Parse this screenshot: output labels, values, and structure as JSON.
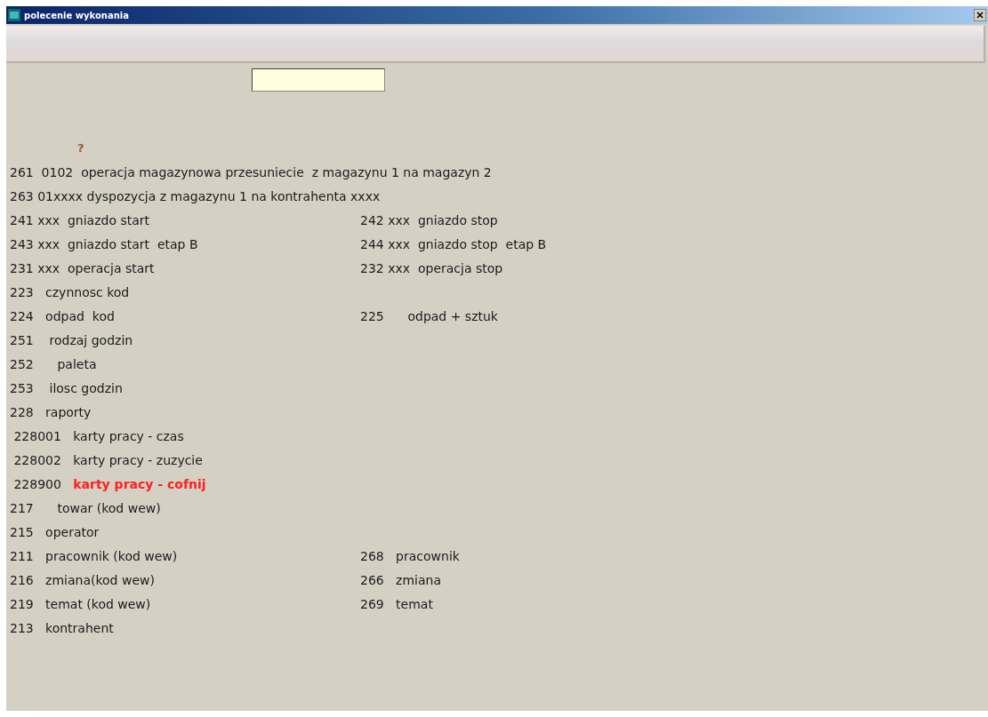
{
  "window": {
    "title": "polecenie wykonania"
  },
  "hint": "?",
  "lines": [
    {
      "left": {
        "text": "261  0102  operacja magazynowa przesuniecie  z magazynu 1 na magazyn 2",
        "color": "#1a1a1a"
      }
    },
    {
      "left": {
        "text": "263 01xxxx dyspozycja z magazynu 1 na kontrahenta xxxx",
        "color": "#1a1a1a"
      }
    },
    {
      "left": {
        "text": "241 xxx  gniazdo start",
        "color": "#1a1a1a"
      },
      "right": {
        "text": "242 xxx  gniazdo stop",
        "color": "#1a1a1a"
      }
    },
    {
      "left": {
        "text": "243 xxx  gniazdo start  etap B",
        "color": "#1a1a1a"
      },
      "right": {
        "text": "244 xxx  gniazdo stop  etap B",
        "color": "#1a1a1a"
      }
    },
    {
      "left": {
        "text": "231 xxx  operacja start",
        "color": "#1a1a1a"
      },
      "right": {
        "text": "232 xxx  operacja stop",
        "color": "#1a1a1a"
      }
    },
    {
      "left": {
        "text": "223   czynnosc kod",
        "color": "#1a1a1a"
      }
    },
    {
      "left": {
        "text": "224   odpad  kod",
        "color": "#1a1a1a"
      },
      "right": {
        "text": "225      odpad + sztuk",
        "color": "#1a1a1a"
      }
    },
    {
      "left": {
        "text": "251    rodzaj godzin",
        "color": "#1a1a1a"
      }
    },
    {
      "left": {
        "text": "252      paleta",
        "color": "#1a1a1a"
      }
    },
    {
      "left": {
        "text": "253    ilosc godzin",
        "color": "#1a1a1a"
      }
    },
    {
      "left": {
        "text": "228   raporty",
        "color": "#1a1a1a"
      }
    },
    {
      "left": {
        "text": " 228001   karty pracy - czas",
        "color": "#1a1a1a"
      }
    },
    {
      "left": {
        "text": " 228002   karty pracy - zuzycie",
        "color": "#1a1a1a"
      }
    },
    {
      "left": {
        "text": " 228900   ",
        "color": "#1a1a1a"
      },
      "extra": {
        "text": "karty pracy - cofnij",
        "color": "#ff2020"
      }
    },
    {
      "left": {
        "text": "217      towar (kod wew)",
        "color": "#1a1a1a"
      }
    },
    {
      "left": {
        "text": "215   operator",
        "color": "#1a1a1a"
      }
    },
    {
      "left": {
        "text": "211   pracownik (kod wew)",
        "color": "#1a1a1a"
      },
      "right": {
        "text": "268   pracownik",
        "color": "#1a1a1a"
      }
    },
    {
      "left": {
        "text": "216   zmiana(kod wew)",
        "color": "#1a1a1a"
      },
      "right": {
        "text": "266   zmiana",
        "color": "#1a1a1a"
      }
    },
    {
      "left": {
        "text": "219   temat (kod wew)",
        "color": "#1a1a1a"
      },
      "right": {
        "text": "269   temat",
        "color": "#1a1a1a"
      }
    },
    {
      "left": {
        "text": "213   kontrahent",
        "color": "#1a1a1a"
      }
    }
  ]
}
